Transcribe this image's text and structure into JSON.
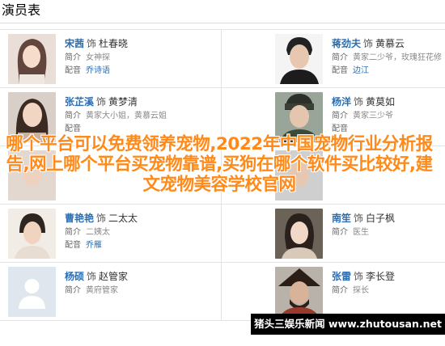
{
  "page": {
    "title": "演员表"
  },
  "labels": {
    "as_word": "饰",
    "intro_key": "简介",
    "dub_key": "配音"
  },
  "cast": [
    {
      "actor": "宋茜",
      "role": "杜春晓",
      "intro": "女神探",
      "dub": "乔诗语"
    },
    {
      "actor": "蒋劲夫",
      "role": "黄慕云",
      "intro": "黄家二少爷，玫瑰狂花修",
      "dub": "边江"
    },
    {
      "actor": "张芷溪",
      "role": "黄梦清",
      "intro": "黄家大小姐，黄慕云姐",
      "dub": ""
    },
    {
      "actor": "杨洋",
      "role": "黄莫如",
      "intro": "黄家三少爷",
      "dub": ""
    },
    {
      "actor": "",
      "role": "",
      "intro": "",
      "dub": ""
    },
    {
      "actor": "",
      "role": "",
      "intro": "",
      "dub": ""
    },
    {
      "actor": "曹艳艳",
      "role": "二太太",
      "intro": "二姨太",
      "dub": "乔雁"
    },
    {
      "actor": "南笙",
      "role": "白子枫",
      "intro": "医生",
      "dub": ""
    },
    {
      "actor": "杨硕",
      "role": "赵管家",
      "intro": "黄府管家",
      "dub": ""
    },
    {
      "actor": "张雷",
      "role": "李长登",
      "intro": "探长",
      "dub": ""
    }
  ],
  "overlay": {
    "text": "哪个平台可以免费领养宠物,2022年中国宠物行业分析报告,网上哪个平台买宠物靠谱,买狗在哪个软件买比较好,建文宠物美容学校官网"
  },
  "watermark": {
    "text": "猪头三娱乐新闻 www.zhutousan.net"
  },
  "colors": {
    "link": "#2c6db0",
    "overlay": "#ff8a1a"
  },
  "icons": {
    "placeholder": "person-silhouette-icon"
  }
}
